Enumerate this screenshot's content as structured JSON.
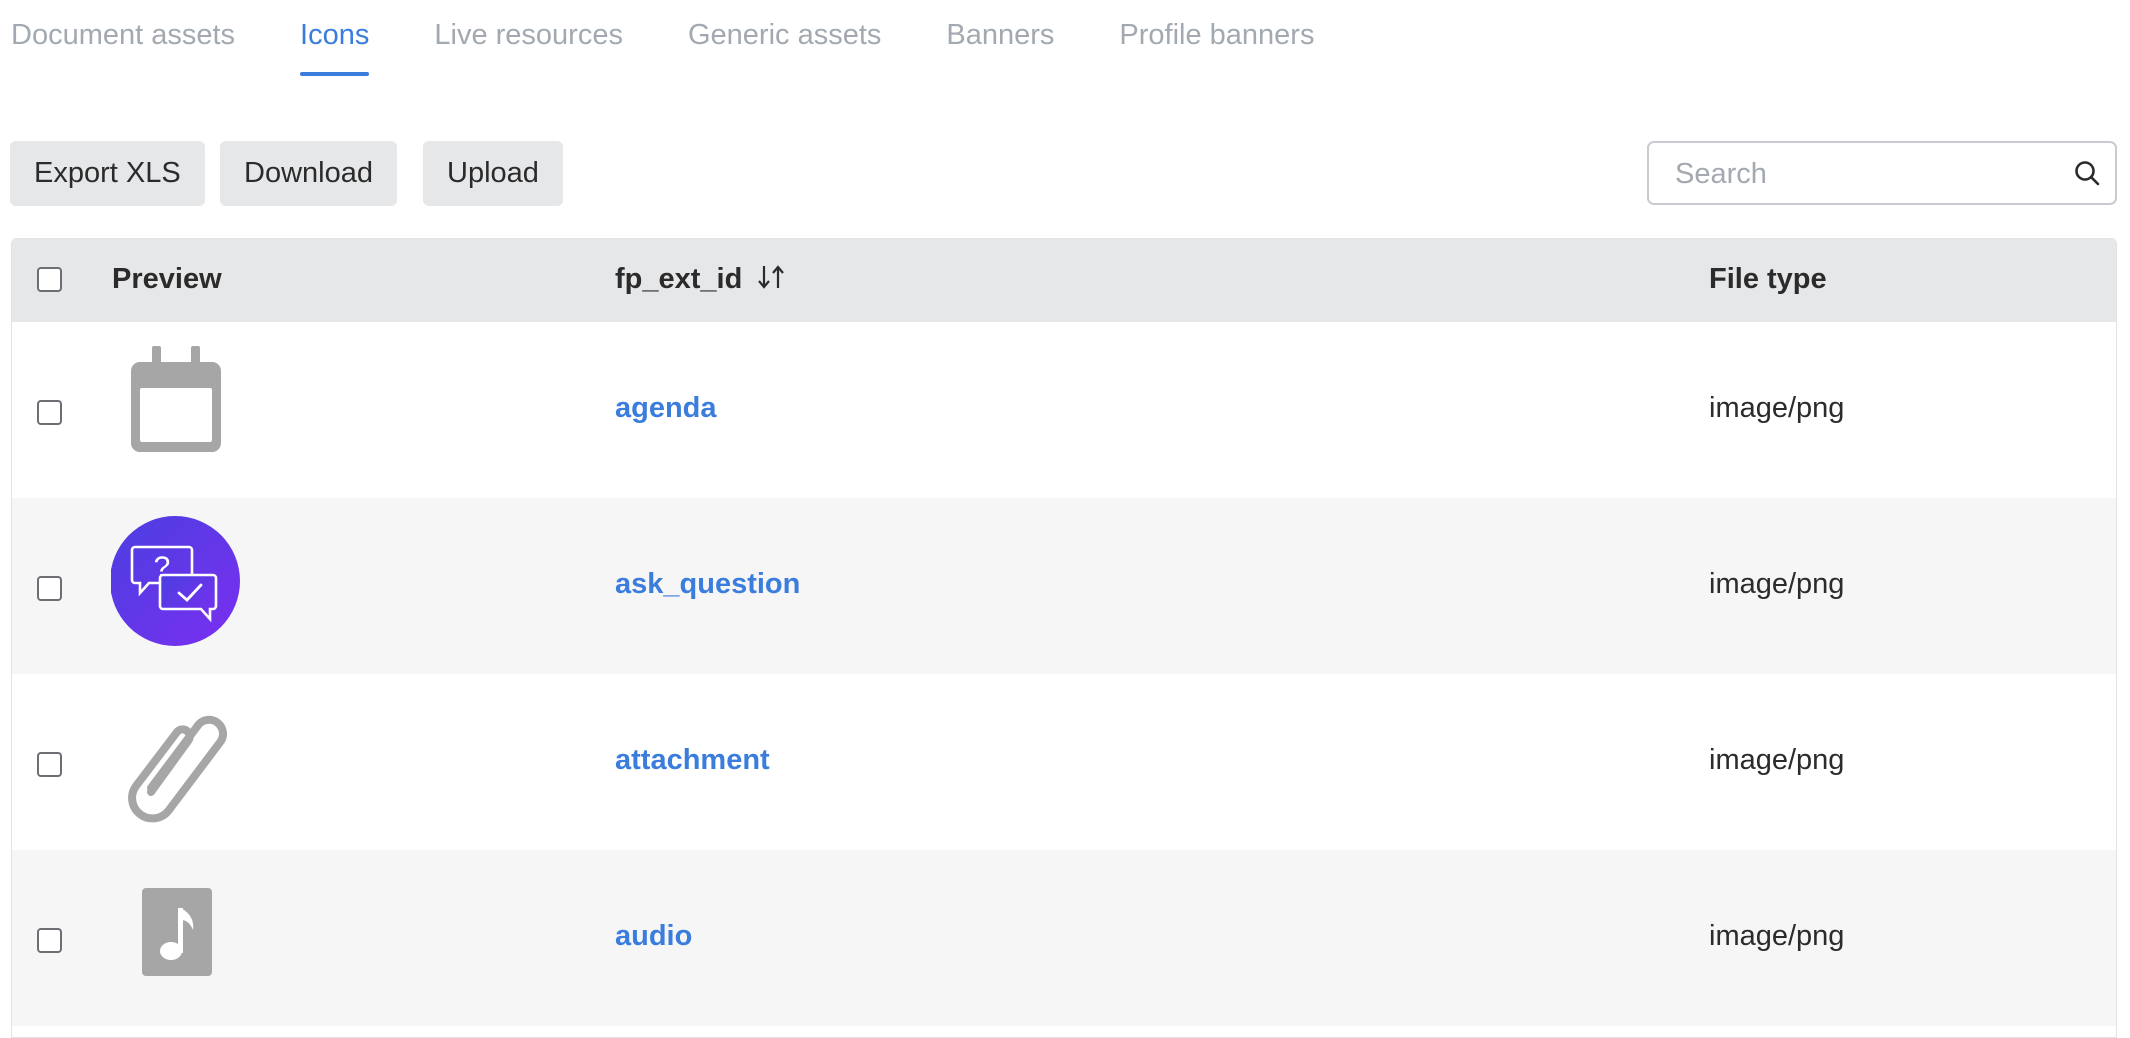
{
  "tabs": [
    {
      "label": "Document assets",
      "active": false
    },
    {
      "label": "Icons",
      "active": true
    },
    {
      "label": "Live resources",
      "active": false
    },
    {
      "label": "Generic assets",
      "active": false
    },
    {
      "label": "Banners",
      "active": false
    },
    {
      "label": "Profile banners",
      "active": false
    }
  ],
  "toolbar": {
    "export_label": "Export XLS",
    "download_label": "Download",
    "upload_label": "Upload"
  },
  "search": {
    "placeholder": "Search",
    "value": ""
  },
  "table": {
    "columns": {
      "preview": "Preview",
      "fp_ext_id": "fp_ext_id",
      "file_type": "File type"
    },
    "sort_icon": "sort-arrows-icon",
    "rows": [
      {
        "fp_ext_id": "agenda",
        "file_type": "image/png",
        "preview_icon": "calendar-icon"
      },
      {
        "fp_ext_id": "ask_question",
        "file_type": "image/png",
        "preview_icon": "chat-question-icon"
      },
      {
        "fp_ext_id": "attachment",
        "file_type": "image/png",
        "preview_icon": "paperclip-icon"
      },
      {
        "fp_ext_id": "audio",
        "file_type": "image/png",
        "preview_icon": "music-note-icon"
      }
    ]
  },
  "colors": {
    "accent": "#3b7ddd",
    "tab_inactive": "#a3a9b0",
    "header_bg": "#e6e7e9",
    "row_alt_bg": "#f6f6f7",
    "icon_gray": "#a6a6a6",
    "purple_start": "#4a3fe0",
    "purple_end": "#7b2ff0"
  }
}
